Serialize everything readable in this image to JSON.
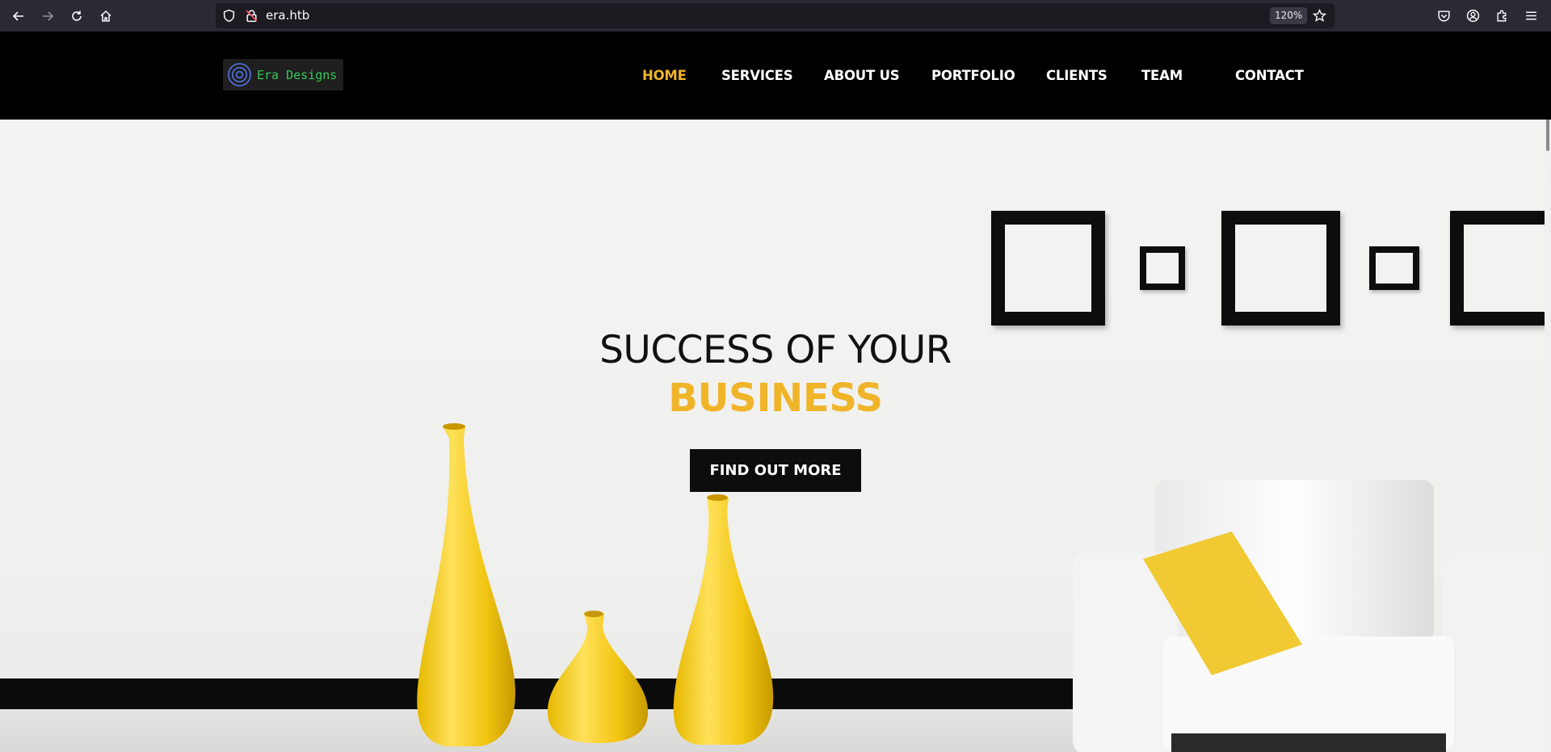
{
  "browser": {
    "url": "era.htb",
    "zoom": "120%"
  },
  "site": {
    "logo_text": "Era Designs",
    "nav": [
      {
        "label": "HOME"
      },
      {
        "label": "SERVICES"
      },
      {
        "label": "ABOUT US"
      },
      {
        "label": "PORTFOLIO"
      },
      {
        "label": "CLIENTS"
      },
      {
        "label": "TEAM"
      },
      {
        "label": "CONTACT"
      }
    ],
    "accent_color": "#f0b429"
  },
  "hero": {
    "line1": "SUCCESS OF YOUR",
    "line2": "BUSINESS",
    "cta": "FIND OUT MORE"
  }
}
